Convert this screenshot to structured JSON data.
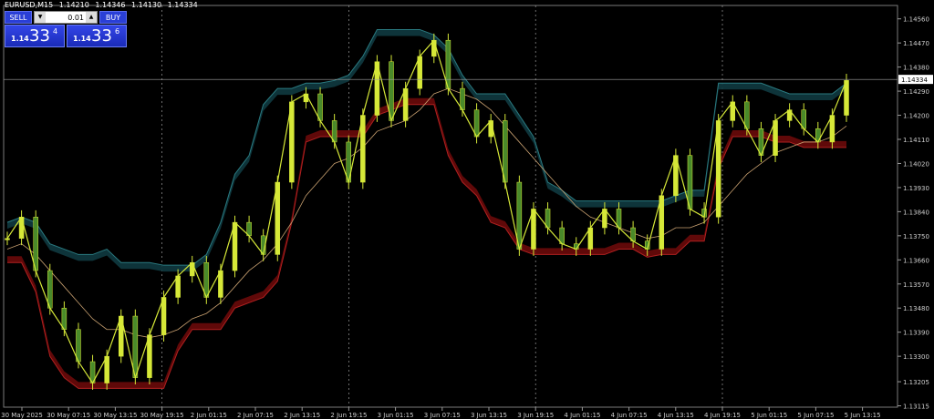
{
  "header": {
    "symbol": "EURUSD,M15",
    "open": "1.14210",
    "high": "1.14346",
    "low": "1.14130",
    "close": "1.14334"
  },
  "trade_panel": {
    "sell_label": "SELL",
    "buy_label": "BUY",
    "lot": "0.01",
    "sell_price": {
      "small": "1.14",
      "big": "33",
      "sup": "4"
    },
    "buy_price": {
      "small": "1.14",
      "big": "33",
      "sup": "6"
    }
  },
  "colors": {
    "background": "#000000",
    "axis_text": "#cfcfcf",
    "candle": "#d6e838",
    "candle_dark": "#4a8a2a",
    "upper_band": "#0f3a40",
    "lower_band": "#6a0a0a",
    "ma": "#c8a070",
    "price_line": "#a0a0a0"
  },
  "chart_data": {
    "type": "line",
    "title": "",
    "ylim": [
      1.1311,
      1.1461
    ],
    "y_ticks": [
      "1.14560",
      "1.14470",
      "1.14380",
      "1.14290",
      "1.14200",
      "1.14110",
      "1.14020",
      "1.13930",
      "1.13840",
      "1.13750",
      "1.13660",
      "1.13570",
      "1.13480",
      "1.13390",
      "1.13300",
      "1.13205",
      "1.13115"
    ],
    "x_ticks": [
      "30 May 2025",
      "30 May 07:15",
      "30 May 13:15",
      "30 May 19:15",
      "2 Jun 01:15",
      "2 Jun 07:15",
      "2 Jun 13:15",
      "2 Jun 19:15",
      "3 Jun 01:15",
      "3 Jun 07:15",
      "3 Jun 13:15",
      "3 Jun 19:15",
      "4 Jun 01:15",
      "4 Jun 07:15",
      "4 Jun 13:15",
      "4 Jun 19:15",
      "5 Jun 01:15",
      "5 Jun 07:15",
      "5 Jun 13:15"
    ],
    "current_price": "1.14334",
    "session_separators": [
      "30 May 19:15",
      "2 Jun 19:15",
      "3 Jun 19:15",
      "4 Jun 19:15"
    ],
    "series": [
      {
        "values": [
          1.1374,
          1.1382,
          1.1362,
          1.1348,
          1.134,
          1.1328,
          1.132,
          1.133,
          1.1345,
          1.1322,
          1.1338,
          1.1352,
          1.136,
          1.1365,
          1.1352,
          1.1362,
          1.138,
          1.1375,
          1.1368,
          1.1395,
          1.1425,
          1.1428,
          1.1418,
          1.141,
          1.1395,
          1.142,
          1.144,
          1.1418,
          1.143,
          1.1442,
          1.1448,
          1.143,
          1.1422,
          1.1412,
          1.1418,
          1.1395,
          1.137,
          1.1385,
          1.1378,
          1.1372,
          1.137,
          1.1378,
          1.1385,
          1.1378,
          1.1373,
          1.137,
          1.139,
          1.1405,
          1.1385,
          1.1382,
          1.1418,
          1.1425,
          1.1415,
          1.1405,
          1.1418,
          1.1422,
          1.1415,
          1.141,
          1.142,
          1.1433
        ]
      },
      {
        "values": [
          1.138,
          1.1382,
          1.138,
          1.1372,
          1.137,
          1.1368,
          1.1368,
          1.137,
          1.1365,
          1.1365,
          1.1365,
          1.1364,
          1.1364,
          1.1364,
          1.1368,
          1.138,
          1.1398,
          1.1405,
          1.1424,
          1.143,
          1.143,
          1.1432,
          1.1432,
          1.1433,
          1.1435,
          1.1442,
          1.1452,
          1.1452,
          1.1452,
          1.1452,
          1.145,
          1.1445,
          1.1435,
          1.1428,
          1.1428,
          1.1428,
          1.142,
          1.1412,
          1.1395,
          1.1392,
          1.1388,
          1.1388,
          1.1388,
          1.1388,
          1.1388,
          1.1388,
          1.1388,
          1.139,
          1.1392,
          1.1392,
          1.1432,
          1.1432,
          1.1432,
          1.1432,
          1.143,
          1.1428,
          1.1428,
          1.1428,
          1.1428,
          1.1432
        ]
      },
      {
        "values": [
          1.1365,
          1.1365,
          1.1354,
          1.133,
          1.1322,
          1.1318,
          1.1318,
          1.1318,
          1.1318,
          1.1318,
          1.1318,
          1.1318,
          1.1332,
          1.134,
          1.134,
          1.134,
          1.1348,
          1.135,
          1.1352,
          1.1358,
          1.138,
          1.141,
          1.1412,
          1.1412,
          1.1412,
          1.1412,
          1.142,
          1.1422,
          1.1424,
          1.1424,
          1.1424,
          1.1405,
          1.1395,
          1.139,
          1.138,
          1.1378,
          1.137,
          1.1368,
          1.1368,
          1.1368,
          1.1368,
          1.1368,
          1.1368,
          1.137,
          1.137,
          1.1367,
          1.1368,
          1.1368,
          1.1373,
          1.1373,
          1.14,
          1.1412,
          1.1412,
          1.1412,
          1.141,
          1.141,
          1.1408,
          1.1408,
          1.1408,
          1.1408
        ]
      },
      {
        "values": [
          1.137,
          1.1372,
          1.1368,
          1.1362,
          1.1356,
          1.135,
          1.1344,
          1.134,
          1.134,
          1.1338,
          1.1337,
          1.1338,
          1.134,
          1.1344,
          1.1346,
          1.135,
          1.1356,
          1.1362,
          1.1366,
          1.1372,
          1.138,
          1.139,
          1.1396,
          1.1402,
          1.1404,
          1.1408,
          1.1414,
          1.1416,
          1.1418,
          1.1422,
          1.1428,
          1.143,
          1.1428,
          1.1426,
          1.1422,
          1.1416,
          1.141,
          1.1404,
          1.1398,
          1.1392,
          1.1386,
          1.1382,
          1.138,
          1.1378,
          1.1376,
          1.1374,
          1.1375,
          1.1378,
          1.1378,
          1.138,
          1.1386,
          1.1392,
          1.1398,
          1.1402,
          1.1406,
          1.1408,
          1.141,
          1.141,
          1.1412,
          1.1416
        ]
      }
    ]
  }
}
